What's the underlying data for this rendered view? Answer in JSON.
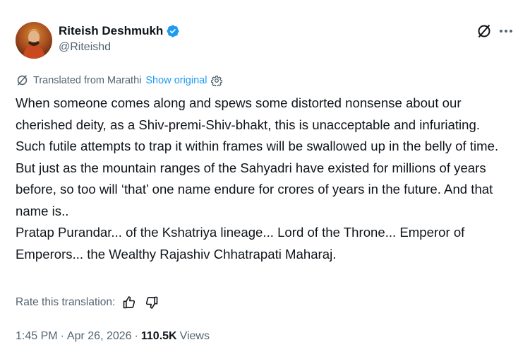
{
  "author": {
    "display_name": "Riteish Deshmukh",
    "handle": "@Riteishd",
    "verified": true,
    "avatar_icon": "avatar-warrior-portrait"
  },
  "actions": {
    "grok_icon": "grok-slash-icon",
    "more_icon": "more-horizontal-icon"
  },
  "translation": {
    "label": "Translated from Marathi",
    "show_original": "Show original"
  },
  "body": {
    "lines": [
      "When someone comes along and spews some distorted nonsense about our cherished deity, as a Shiv-premi-Shiv-bhakt, this is unacceptable and infuriating.",
      "Such futile attempts to trap it within frames will be swallowed up in the belly of time. But just as the mountain ranges of the Sahyadri have existed for millions of years before, so too will ‘that’ one name endure for crores of years in the future. And that name is..",
      "Pratap Purandar... of the Kshatriya lineage... Lord of the Throne... Emperor of Emperors... the Wealthy Rajashiv Chhatrapati Maharaj."
    ]
  },
  "rating": {
    "label": "Rate this translation:"
  },
  "meta": {
    "time": "1:45 PM",
    "separator": "·",
    "date": "Apr 26, 2026",
    "views_count": "110.5K",
    "views_label": "Views"
  },
  "colors": {
    "text": "#0f1419",
    "secondary": "#536471",
    "link": "#1d9bf0",
    "verified": "#1d9bf0"
  }
}
